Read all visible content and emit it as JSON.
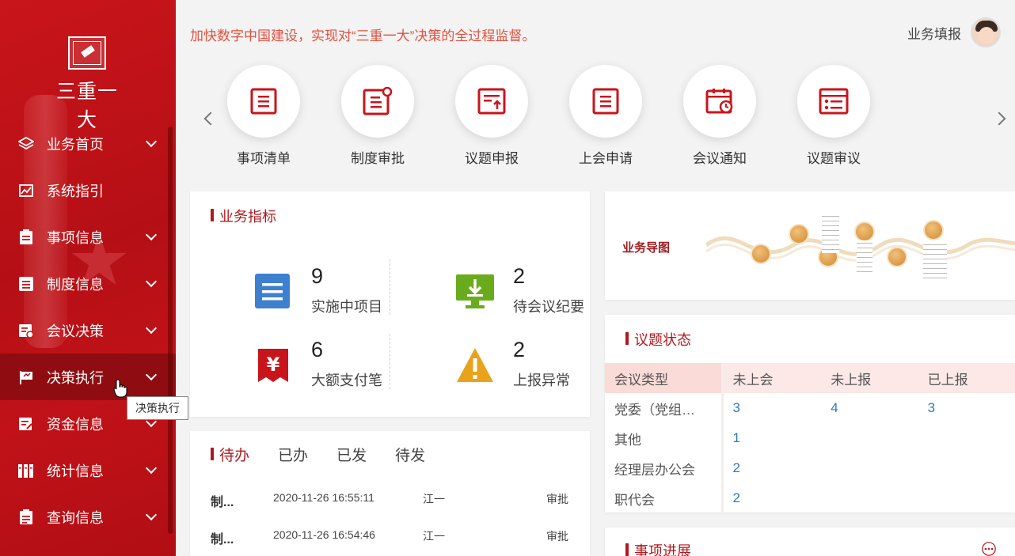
{
  "sidebar": {
    "logo_text": "三重一大",
    "items": [
      {
        "label": "业务首页"
      },
      {
        "label": "系统指引"
      },
      {
        "label": "事项信息"
      },
      {
        "label": "制度信息"
      },
      {
        "label": "会议决策"
      },
      {
        "label": "决策执行"
      },
      {
        "label": "资金信息"
      },
      {
        "label": "统计信息"
      },
      {
        "label": "查询信息"
      }
    ],
    "tooltip": "决策执行"
  },
  "header": {
    "slogan": "加快数字中国建设，实现对“三重一大”决策的全过程监督。",
    "user_label": "业务填报"
  },
  "quicknav": [
    {
      "label": "事项清单"
    },
    {
      "label": "制度审批"
    },
    {
      "label": "议题申报"
    },
    {
      "label": "上会申请"
    },
    {
      "label": "会议通知"
    },
    {
      "label": "议题审议"
    }
  ],
  "metrics": {
    "title": "业务指标",
    "items": [
      {
        "value": "9",
        "label": "实施中项目"
      },
      {
        "value": "2",
        "label": "待会议纪要"
      },
      {
        "value": "6",
        "label": "大额支付笔"
      },
      {
        "value": "2",
        "label": "上报异常"
      }
    ]
  },
  "todo": {
    "tabs": [
      "待办",
      "已办",
      "已发",
      "待发"
    ],
    "rows": [
      {
        "name": "制...",
        "time": "2020-11-26 16:55:11",
        "user": "江一",
        "type": "审批"
      },
      {
        "name": "制...",
        "time": "2020-11-26 16:54:46",
        "user": "江一",
        "type": "审批"
      }
    ]
  },
  "map": {
    "title": "业务导图"
  },
  "status": {
    "title": "议题状态",
    "headers": [
      "会议类型",
      "未上会",
      "未上报",
      "已上报"
    ],
    "rows": [
      [
        "党委（党组…",
        "3",
        "4",
        "3"
      ],
      [
        "其他",
        "1",
        "",
        ""
      ],
      [
        "经理层办公会",
        "2",
        "",
        ""
      ],
      [
        "职代会",
        "2",
        "",
        ""
      ]
    ]
  },
  "progress": {
    "title": "事项进展"
  },
  "colors": {
    "brand_red": "#c8151b",
    "accent_red": "#b01a1f",
    "link_blue": "#2d7bbf"
  }
}
